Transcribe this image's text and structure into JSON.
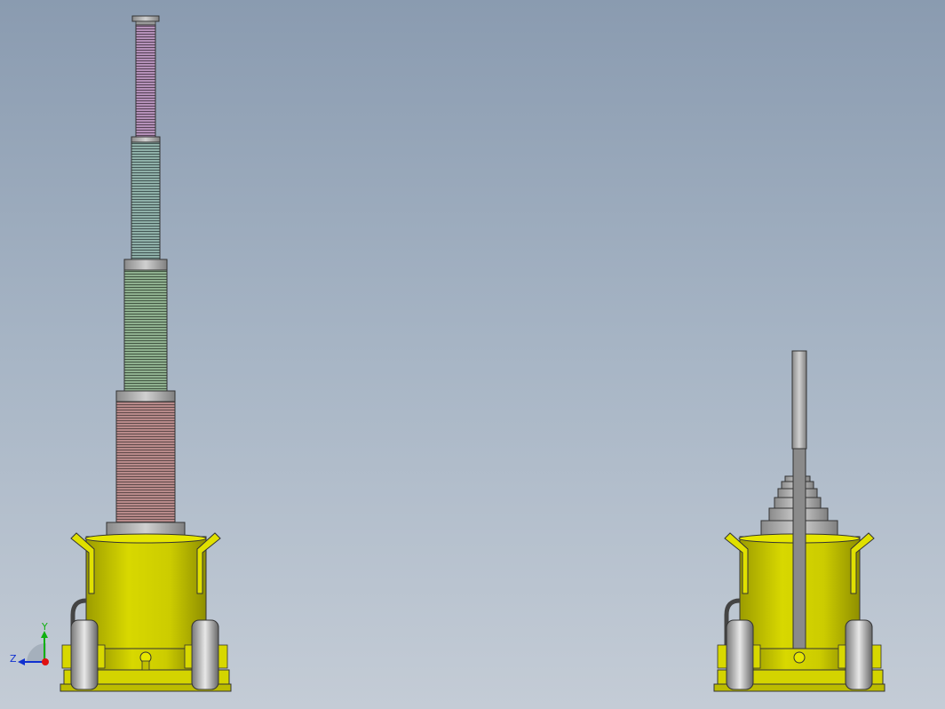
{
  "view": {
    "background_top": "#8a9bb0",
    "background_bottom": "#c4ccd6"
  },
  "models": [
    {
      "name": "jack-extended-side-view",
      "body_color": "#d4d400",
      "stage_colors": [
        "#b88a8a",
        "#8fb08f",
        "#8fb0a8",
        "#b490b8"
      ]
    },
    {
      "name": "jack-retracted-front-view",
      "body_color": "#d4d400",
      "handle_color": "#a8a8a8"
    }
  ],
  "triad": {
    "y_label": "Y",
    "z_label": "Z",
    "y_color": "#10b010",
    "z_color": "#1030d0",
    "origin_color": "#e01010"
  }
}
